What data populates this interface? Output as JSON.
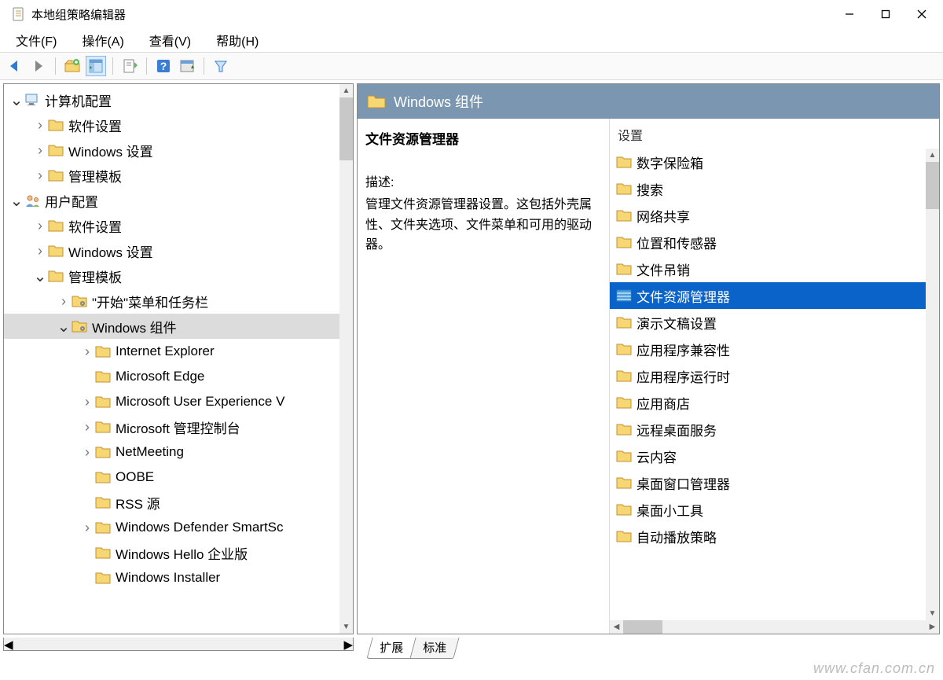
{
  "window": {
    "title": "本地组策略编辑器"
  },
  "menu": {
    "file": "文件(F)",
    "action": "操作(A)",
    "view": "查看(V)",
    "help": "帮助(H)"
  },
  "tree": {
    "items": [
      {
        "level": 0,
        "chev": "v",
        "icon": "computer",
        "label": "计算机配置"
      },
      {
        "level": 1,
        "chev": ">",
        "icon": "folder",
        "label": "软件设置"
      },
      {
        "level": 1,
        "chev": ">",
        "icon": "folder",
        "label": "Windows 设置"
      },
      {
        "level": 1,
        "chev": ">",
        "icon": "folder",
        "label": "管理模板"
      },
      {
        "level": 0,
        "chev": "v",
        "icon": "user",
        "label": "用户配置"
      },
      {
        "level": 1,
        "chev": ">",
        "icon": "folder",
        "label": "软件设置"
      },
      {
        "level": 1,
        "chev": ">",
        "icon": "folder",
        "label": "Windows 设置"
      },
      {
        "level": 1,
        "chev": "v",
        "icon": "folder",
        "label": "管理模板"
      },
      {
        "level": 2,
        "chev": ">",
        "icon": "folder-gear",
        "label": "\"开始\"菜单和任务栏"
      },
      {
        "level": 2,
        "chev": "v",
        "icon": "folder-gear",
        "label": "Windows 组件",
        "selected": true
      },
      {
        "level": 3,
        "chev": ">",
        "icon": "folder",
        "label": "Internet Explorer"
      },
      {
        "level": 3,
        "chev": " ",
        "icon": "folder",
        "label": "Microsoft Edge"
      },
      {
        "level": 3,
        "chev": ">",
        "icon": "folder",
        "label": "Microsoft User Experience V"
      },
      {
        "level": 3,
        "chev": ">",
        "icon": "folder",
        "label": "Microsoft 管理控制台"
      },
      {
        "level": 3,
        "chev": ">",
        "icon": "folder",
        "label": "NetMeeting"
      },
      {
        "level": 3,
        "chev": " ",
        "icon": "folder",
        "label": "OOBE"
      },
      {
        "level": 3,
        "chev": " ",
        "icon": "folder",
        "label": "RSS 源"
      },
      {
        "level": 3,
        "chev": ">",
        "icon": "folder",
        "label": "Windows Defender SmartSc"
      },
      {
        "level": 3,
        "chev": " ",
        "icon": "folder",
        "label": "Windows Hello 企业版"
      },
      {
        "level": 3,
        "chev": " ",
        "icon": "folder",
        "label": "Windows Installer"
      }
    ]
  },
  "right": {
    "header": "Windows 组件",
    "desc_title": "文件资源管理器",
    "desc_label": "描述:",
    "desc_text": "管理文件资源管理器设置。这包括外壳属性、文件夹选项、文件菜单和可用的驱动器。",
    "list_header": "设置",
    "items": [
      {
        "label": "数字保险箱",
        "selected": false
      },
      {
        "label": "搜索",
        "selected": false
      },
      {
        "label": "网络共享",
        "selected": false
      },
      {
        "label": "位置和传感器",
        "selected": false
      },
      {
        "label": "文件吊销",
        "selected": false
      },
      {
        "label": "文件资源管理器",
        "selected": true
      },
      {
        "label": "演示文稿设置",
        "selected": false
      },
      {
        "label": "应用程序兼容性",
        "selected": false
      },
      {
        "label": "应用程序运行时",
        "selected": false
      },
      {
        "label": "应用商店",
        "selected": false
      },
      {
        "label": "远程桌面服务",
        "selected": false
      },
      {
        "label": "云内容",
        "selected": false
      },
      {
        "label": "桌面窗口管理器",
        "selected": false
      },
      {
        "label": "桌面小工具",
        "selected": false
      },
      {
        "label": "自动播放策略",
        "selected": false
      }
    ]
  },
  "tabs": {
    "extended": "扩展",
    "standard": "标准"
  },
  "watermark": "www.cfan.com.cn"
}
